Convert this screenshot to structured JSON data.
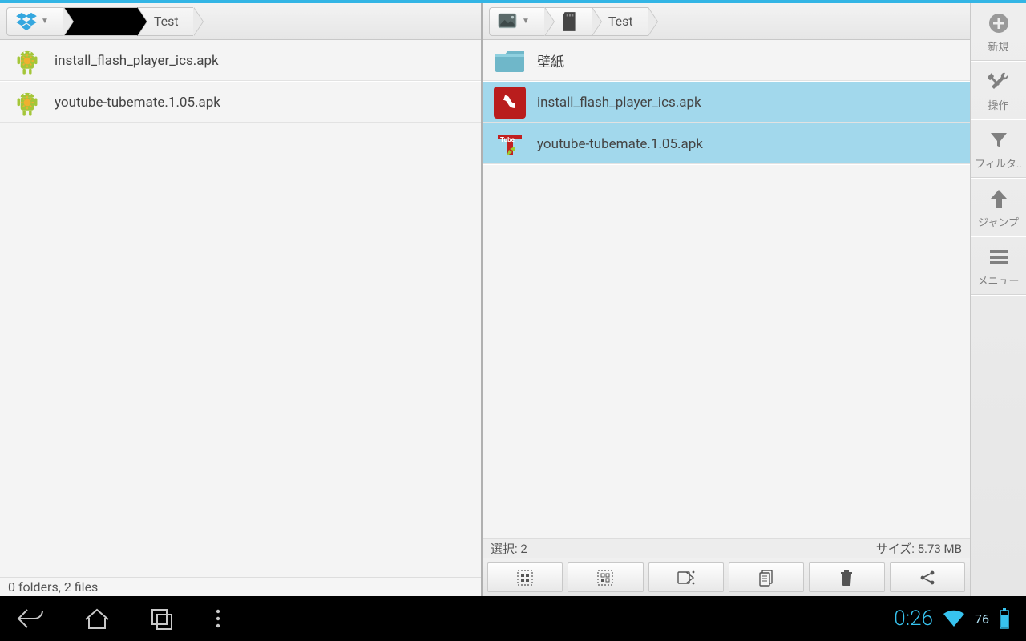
{
  "accentColor": "#33b5e5",
  "leftPane": {
    "breadcrumb": {
      "rootIcon": "dropbox",
      "redactedSegment": true,
      "current": "Test"
    },
    "files": [
      {
        "icon": "android-apk",
        "name": "install_flash_player_ics.apk",
        "selected": false
      },
      {
        "icon": "android-apk",
        "name": "youtube-tubemate.1.05.apk",
        "selected": false
      }
    ],
    "status": "0 folders, 2 files"
  },
  "rightPane": {
    "breadcrumb": {
      "rootIcon": "gallery",
      "segmentIcon": "sdcard",
      "current": "Test"
    },
    "files": [
      {
        "icon": "folder",
        "name": "壁紙",
        "selected": false
      },
      {
        "icon": "flash-app",
        "name": "install_flash_player_ics.apk",
        "selected": true
      },
      {
        "icon": "tubemate-app",
        "name": "youtube-tubemate.1.05.apk",
        "selected": true
      }
    ],
    "status": {
      "selectionLabel": "選択: 2",
      "sizeLabel": "サイズ: 5.73 MB"
    },
    "toolbar": [
      {
        "id": "select-all",
        "icon": "select-all"
      },
      {
        "id": "select-none",
        "icon": "select-none"
      },
      {
        "id": "cut",
        "icon": "cut"
      },
      {
        "id": "copy",
        "icon": "copy"
      },
      {
        "id": "delete",
        "icon": "delete"
      },
      {
        "id": "share",
        "icon": "share"
      }
    ]
  },
  "sidebar": [
    {
      "id": "new",
      "label": "新規",
      "icon": "plus-circle"
    },
    {
      "id": "operate",
      "label": "操作",
      "icon": "tools"
    },
    {
      "id": "filter",
      "label": "フィルタ..",
      "icon": "funnel"
    },
    {
      "id": "jump",
      "label": "ジャンプ",
      "icon": "arrow-up"
    },
    {
      "id": "menu",
      "label": "メニュー",
      "icon": "menu"
    }
  ],
  "androidNav": {
    "time": "0:26",
    "batteryPercent": "76"
  }
}
